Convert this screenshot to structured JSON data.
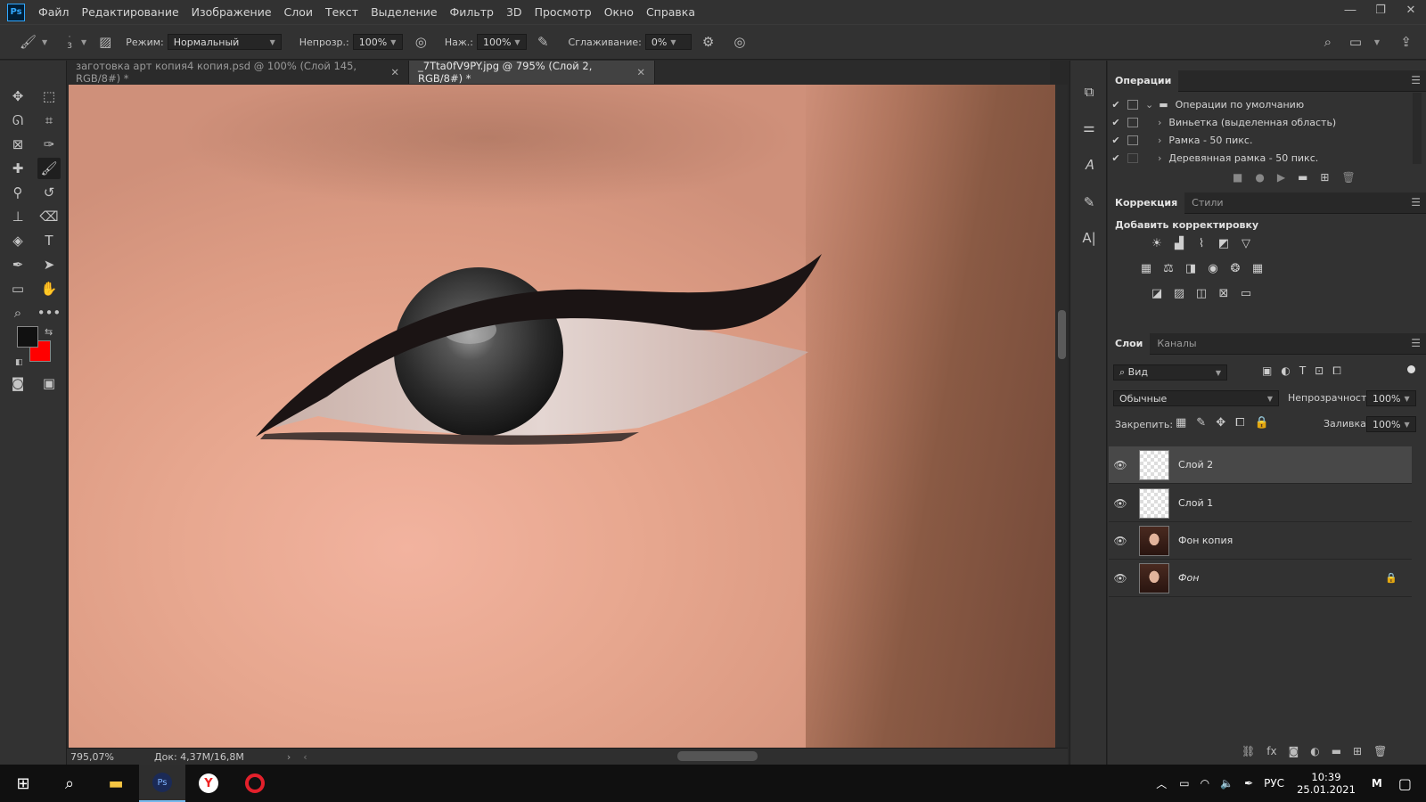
{
  "menubar": {
    "logo": "Ps",
    "items": [
      "Файл",
      "Редактирование",
      "Изображение",
      "Слои",
      "Текст",
      "Выделение",
      "Фильтр",
      "3D",
      "Просмотр",
      "Окно",
      "Справка"
    ]
  },
  "options": {
    "brush_size": "3",
    "mode_label": "Режим:",
    "mode_value": "Нормальный",
    "opacity_label": "Непрозр.:",
    "opacity_value": "100%",
    "pressure_label": "Наж.:",
    "pressure_value": "100%",
    "smoothing_label": "Сглаживание:",
    "smoothing_value": "0%"
  },
  "tabs": [
    {
      "label": "заготовка арт копия4 копия.psd @ 100% (Слой 145, RGB/8#) *",
      "close": "✕"
    },
    {
      "label": "_7Tta0fV9PY.jpg @ 795% (Слой 2, RGB/8#) *",
      "close": "✕"
    }
  ],
  "status": {
    "zoom": "795,07%",
    "doc": "Док: 4,37M/16,8M"
  },
  "colors": {
    "foreground": "#111111",
    "background": "#ff0000"
  },
  "actions_panel": {
    "title": "Операции",
    "rows": [
      {
        "label": "Операции по умолчанию",
        "expanded": true
      },
      {
        "label": "Виньетка (выделенная область)"
      },
      {
        "label": "Рамка - 50 пикс."
      },
      {
        "label": "Деревянная рамка - 50 пикс."
      }
    ]
  },
  "adjustments_panel": {
    "tab_active": "Коррекция",
    "tab_other": "Стили",
    "add_label": "Добавить корректировку"
  },
  "layers_panel": {
    "tab_active": "Слои",
    "tab_other": "Каналы",
    "filter_label": "Вид",
    "blend_mode": "Обычные",
    "opacity_label": "Непрозрачность:",
    "opacity_value": "100%",
    "lock_label": "Закрепить:",
    "fill_label": "Заливка:",
    "fill_value": "100%",
    "layers": [
      {
        "name": "Слой 2",
        "selected": true,
        "thumb": "transparent"
      },
      {
        "name": "Слой 1",
        "selected": false,
        "thumb": "transparent"
      },
      {
        "name": "Фон копия",
        "selected": false,
        "thumb": "photo"
      },
      {
        "name": "Фон",
        "selected": false,
        "thumb": "photo",
        "locked": true
      }
    ]
  },
  "taskbar": {
    "lang": "РУС",
    "time": "10:39",
    "date": "25.01.2021"
  }
}
